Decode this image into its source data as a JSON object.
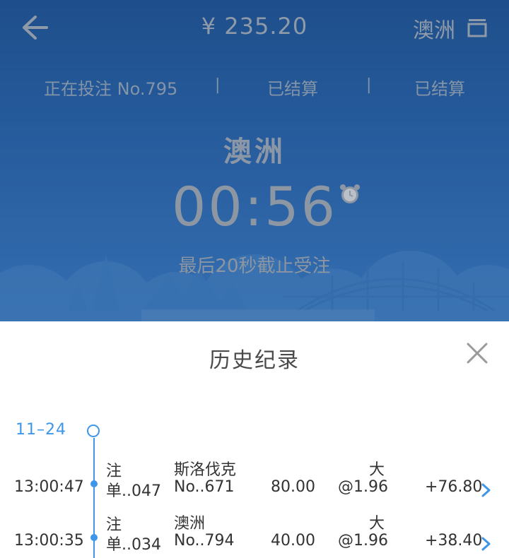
{
  "header": {
    "balance": "¥ 235.20",
    "region": "澳洲"
  },
  "status": {
    "current": "正在投注 No.795",
    "settled_1": "已结算",
    "settled_2": "已结算",
    "separator": "|"
  },
  "draw": {
    "name": "澳洲",
    "countdown": "00:56",
    "notice": "最后20秒截止受注"
  },
  "history": {
    "title": "历史纪录",
    "date": "11–24",
    "rows": [
      {
        "time": "13:00:47",
        "type_line1": "注",
        "type_line2": "单..047",
        "game_line1": "斯洛伐克",
        "game_line2": "No..671",
        "amount": "80.00",
        "pick_line1": "大",
        "pick_line2": "@1.96",
        "win": "+76.80"
      },
      {
        "time": "13:00:35",
        "type_line1": "注",
        "type_line2": "单..034",
        "game_line1": "澳洲",
        "game_line2": "No..794",
        "amount": "40.00",
        "pick_line1": "大",
        "pick_line2": "@1.96",
        "win": "+38.40"
      }
    ]
  },
  "colors": {
    "accent": "#3d96e8",
    "hero_bg": "#2a65ac"
  },
  "icons": {
    "back": "back-arrow-icon",
    "menu": "menu-icon",
    "alarm": "alarm-clock-icon",
    "close": "close-icon",
    "chevron": "chevron-right-icon"
  }
}
